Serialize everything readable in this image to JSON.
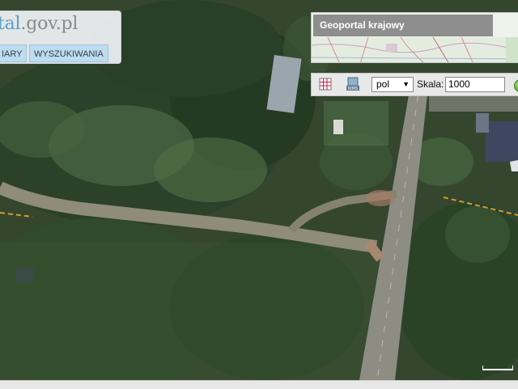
{
  "header": {
    "logo_part1": "tal",
    "logo_part2": ".gov.pl"
  },
  "menu": {
    "buttons": [
      {
        "label": "IARY"
      },
      {
        "label": "WYSZUKIWANIA"
      }
    ]
  },
  "overview_map": {
    "title": "Geoportal krajowy"
  },
  "toolbar": {
    "language_value": "pol",
    "scale_label": "Skala:",
    "scale_value": "1000",
    "icons": [
      "grid-icon",
      "wms-icon",
      "go-icon"
    ]
  },
  "colors": {
    "logo_blue": "#5a9fca",
    "logo_gray": "#8a8a8a",
    "button_blue": "#bfdcef",
    "overview_title_bg": "#8e8e8e"
  }
}
